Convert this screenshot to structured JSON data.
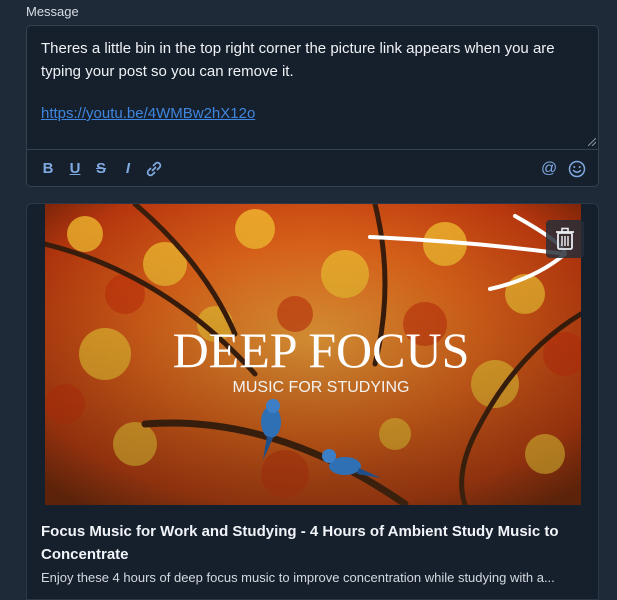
{
  "form": {
    "message_label": "Message",
    "message_text": "Theres a little bin in the top right corner the picture link appears when you are typing your post so you can remove it.",
    "message_link": "https://youtu.be/4WMBw2hX12o"
  },
  "toolbar": {
    "bold": "B",
    "underline": "U",
    "strike": "S",
    "italic": "I",
    "at": "@"
  },
  "preview": {
    "title": "Focus Music for Work and Studying - 4 Hours of Ambient Study Music to Concentrate",
    "description": "Enjoy these 4 hours of deep focus music to improve concentration while studying with a...",
    "meta": "",
    "thumbnail_title": "DEEP FOCUS",
    "thumbnail_subtitle": "MUSIC FOR STUDYING"
  }
}
